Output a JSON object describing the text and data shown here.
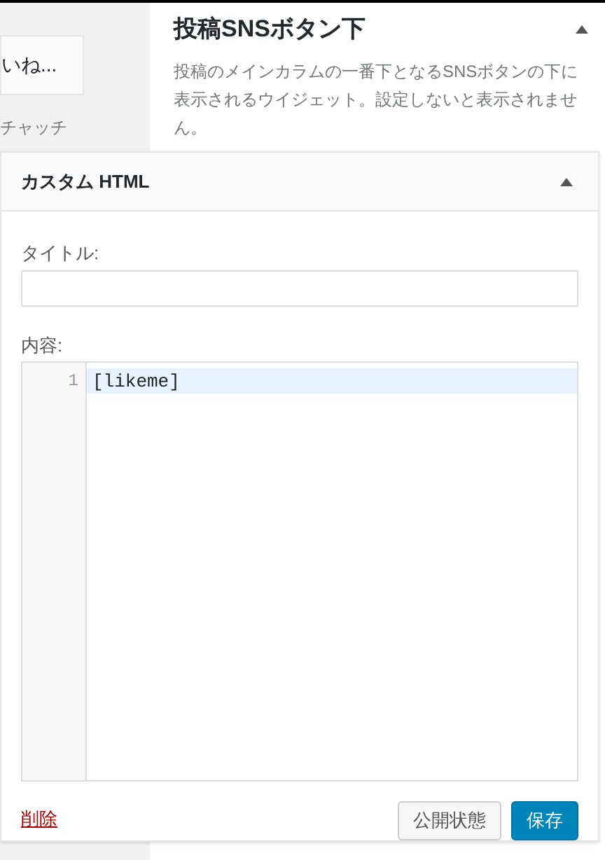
{
  "background": {
    "left_card": {
      "title": "いね..."
    },
    "left_text": "チャッチ",
    "widget": {
      "title": "投稿SNSボタン下",
      "description": "投稿のメインカラムの一番下となるSNSボタンの下に表示されるウイジェット。設定しないと表示されません。",
      "expanded": true
    }
  },
  "open_widget": {
    "title": "カスタム HTML",
    "expanded": true,
    "title_field": {
      "label": "タイトル:"
    },
    "content_field": {
      "label": "内容:",
      "lines": [
        {
          "number": "1",
          "text": "[likeme]",
          "selected": true
        }
      ]
    },
    "delete_link": "削除",
    "buttons": [
      {
        "label": "公開状態",
        "kind": "secondary"
      },
      {
        "label": "保存",
        "kind": "primary"
      }
    ]
  }
}
